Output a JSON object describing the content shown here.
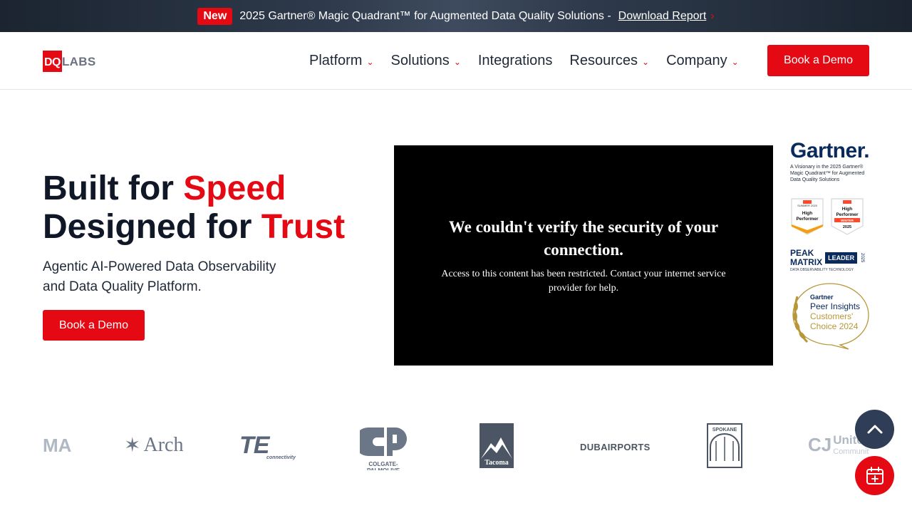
{
  "announcement": {
    "badge": "New",
    "text": "2025 Gartner® Magic Quadrant™ for Augmented Data Quality Solutions -",
    "link": "Download Report"
  },
  "header": {
    "logo_dq": "DQ",
    "logo_labs": "LABS",
    "nav": [
      {
        "label": "Platform",
        "dropdown": true
      },
      {
        "label": "Solutions",
        "dropdown": true
      },
      {
        "label": "Integrations",
        "dropdown": false
      },
      {
        "label": "Resources",
        "dropdown": true
      },
      {
        "label": "Company",
        "dropdown": true
      }
    ],
    "cta": "Book a Demo"
  },
  "hero": {
    "title_line1_a": "Built for ",
    "title_line1_b": "Speed",
    "title_line2_a": "Designed for ",
    "title_line2_b": "Trust",
    "subtitle": "Agentic AI-Powered Data Observability and Data Quality Platform.",
    "cta": "Book a Demo"
  },
  "video": {
    "heading": "We couldn't verify the security of your connection.",
    "body": "Access to this content has been restricted. Contact your internet service provider for help."
  },
  "badges": {
    "gartner": "Gartner.",
    "gartner_caption": "A Visionary in the 2025 Gartner® Magic Quadrant™ for Augmented Data Quality Solutions",
    "g2_left": [
      "SUMMER 2025",
      "High",
      "Performer"
    ],
    "g2_right": [
      "High",
      "Performer",
      "WINTER",
      "2025"
    ],
    "peak": [
      "PEAK",
      "MATRIX"
    ],
    "peak_leader": "LEADER",
    "peak_year": "2025",
    "peak_caption": "DATA OBSERVABILITY TECHNOLOGY",
    "pi": [
      "Gartner",
      "Peer Insights",
      "Customers'",
      "Choice 2024"
    ]
  },
  "customer_logos": {
    "arch": "Arch",
    "te": "TE",
    "te_sub": "connectivity",
    "colgate": "COLGATE-PALMOLIVE",
    "tacoma": "Tacoma",
    "dubai": "DUBAIRPORTS",
    "spokane": "SPOKANE",
    "united": "United",
    "united_sub": "Community"
  },
  "colors": {
    "brand_red": "#e50914",
    "navy": "#101828",
    "fab_dark": "#2f3e56"
  }
}
